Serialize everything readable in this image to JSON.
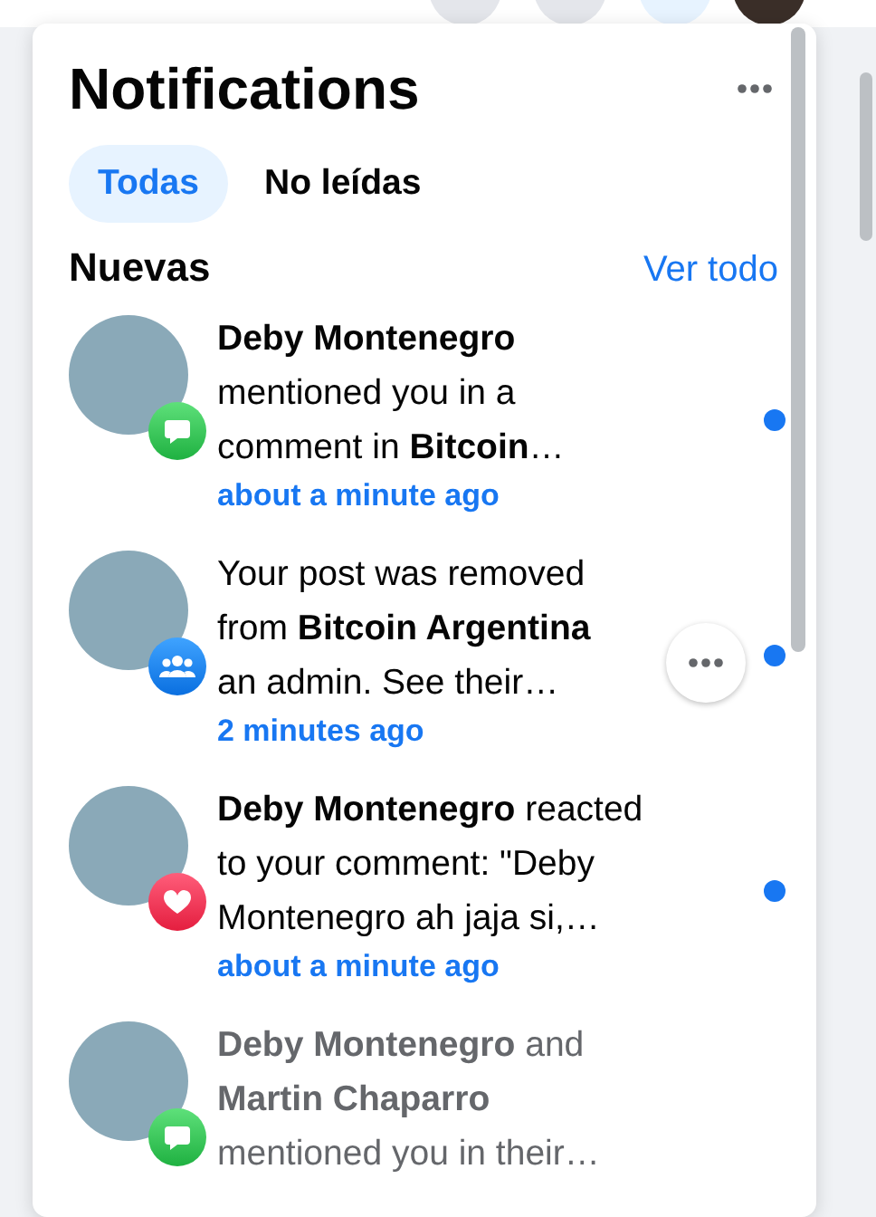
{
  "panel": {
    "title": "Notifications",
    "tabs": [
      {
        "label": "Todas",
        "selected": true
      },
      {
        "label": "No leídas",
        "selected": false
      }
    ],
    "section": {
      "heading": "Nuevas",
      "link": "Ver todo"
    },
    "notifications": [
      {
        "text": "**Deby Montenegro**\nmentioned you in a\ncomment in **Bitcoin**…",
        "time": "about a minute ago",
        "kind": "comment",
        "unread": true,
        "hovered": false
      },
      {
        "text": "Your post was removed\nfrom **Bitcoin Argentina**\nan admin. See their…",
        "time": "2 minutes ago",
        "kind": "group",
        "unread": true,
        "hovered": true
      },
      {
        "text": "**Deby Montenegro** reacted\nto your comment: \"Deby\nMontenegro ah jaja si,…",
        "time": "about a minute ago",
        "kind": "heart",
        "unread": true,
        "hovered": false
      },
      {
        "text": "**Deby Montenegro** and\n**Martin Chaparro**\nmentioned you in their…",
        "kind": "comment",
        "unread": false,
        "hovered": false
      }
    ]
  }
}
